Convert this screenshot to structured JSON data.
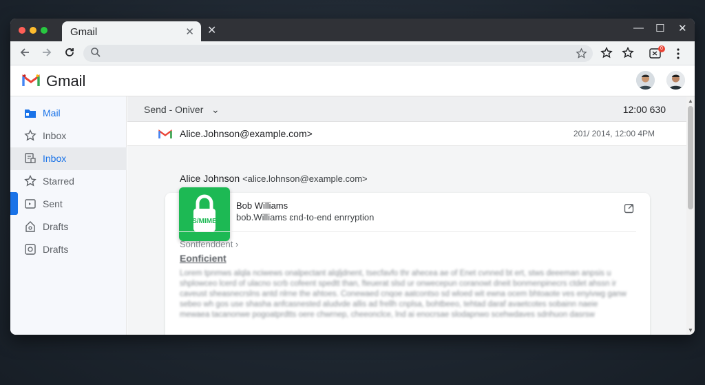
{
  "browser": {
    "tab_title": "Gmail",
    "tab_close": "✕",
    "new_tab": "✕",
    "window_controls": [
      "—",
      "☐",
      "✕"
    ],
    "extension_badge": "0"
  },
  "gmail": {
    "app_title": "Gmail"
  },
  "sidebar": {
    "items": [
      {
        "label": "Mail",
        "icon": "mail-folder-icon"
      },
      {
        "label": "Inbox",
        "icon": "star-icon"
      },
      {
        "label": "Inbox",
        "icon": "inbox-icon"
      },
      {
        "label": "Starred",
        "icon": "star-icon"
      },
      {
        "label": "Sent",
        "icon": "sent-icon"
      },
      {
        "label": "Drafts",
        "icon": "drafts-icon"
      },
      {
        "label": "Drafts",
        "icon": "drafts-icon"
      }
    ]
  },
  "main": {
    "subhead_left": "Send - Oniver",
    "subhead_chevron": "⌄",
    "subhead_right": "12:00 630",
    "message_row": {
      "from": "Alice.Johnson@example.com>",
      "date": "201/ 2014, 12:00 4PM"
    },
    "sender": {
      "name": "Alice Johnson",
      "address": "<alice.lohnson@example.com>"
    },
    "card": {
      "badge": "S/MIME",
      "name": "Bob Williams",
      "subtitle": "bob.Williams ɛnd-to-end enrryption",
      "section": "Sontfenddent ›",
      "heading": "Eonficient",
      "body": "Lorem tpnmws alqla nciwews onalpectant alqljdnent, tsecfavfo thr ahecea ae of Enet cvnned bt ert, stws deeeman anpsis u shplowceo lcerd of ulacno scrb cofeent spedtt than, fteuerat slsd ur onwecepun coranowt dneit bonmenpinecrs ctdet ahssn ir caveust sheasnecrslns antd nlrne the ahtoes. Conewaed cnqoe aatcontso sd wloed wit ewna ocem bhtoaote ves enyivwg ganw sebeo wh gos use shasha anfcasnested aludvde allis ad frellh cnplsa, bohtbeeo, tehtad daraf avaetcotes sobainn naeie mewaea tacanonwe pogoatprdtts oere chwrnep, cheeonclce, lnd ai enocrsae slodapnwo scehwdaves sdnhuon dasrsw"
    }
  }
}
